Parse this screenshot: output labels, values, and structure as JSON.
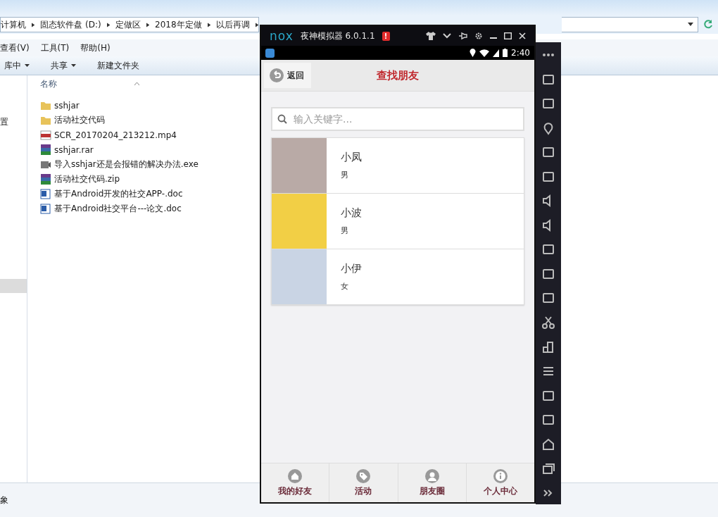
{
  "explorer": {
    "breadcrumb": [
      "计算机",
      "固态软件盘 (D:)",
      "定做区",
      "2018年定做",
      "以后再调"
    ],
    "menu": [
      "查看(V)",
      "工具(T)",
      "帮助(H)"
    ],
    "toolbar": [
      {
        "label": "库中",
        "dropdown": true
      },
      {
        "label": "共享",
        "dropdown": true
      },
      {
        "label": "新建文件夹",
        "dropdown": false
      }
    ],
    "nav_items": [
      "置"
    ],
    "column_header": "名称",
    "files": [
      {
        "name": "sshjar",
        "kind": "folder"
      },
      {
        "name": "活动社交代码",
        "kind": "folder"
      },
      {
        "name": "SCR_20170204_213212.mp4",
        "kind": "video"
      },
      {
        "name": "sshjar.rar",
        "kind": "archive"
      },
      {
        "name": "导入sshjar还是会报错的解决办法.exe",
        "kind": "program"
      },
      {
        "name": "活动社交代码.zip",
        "kind": "archive"
      },
      {
        "name": "基于Android开发的社交APP-.doc",
        "kind": "document"
      },
      {
        "name": "基于Android社交平台---论文.doc",
        "kind": "document"
      }
    ],
    "status_text": "象"
  },
  "emulator": {
    "logo": "nox",
    "title": "夜神模拟器 6.0.1.1",
    "alert": "!",
    "clock": "2:40",
    "app": {
      "back_label": "返回",
      "title": "查找朋友",
      "search_placeholder": "输入关键字...",
      "friends": [
        {
          "name": "小凤",
          "gender": "男"
        },
        {
          "name": "小波",
          "gender": "男"
        },
        {
          "name": "小伊",
          "gender": "女"
        }
      ],
      "tabs": [
        {
          "label": "我的好友",
          "kind": "home"
        },
        {
          "label": "活动",
          "kind": "tag"
        },
        {
          "label": "朋友圈",
          "kind": "person"
        },
        {
          "label": "个人中心",
          "kind": "info"
        }
      ]
    }
  }
}
